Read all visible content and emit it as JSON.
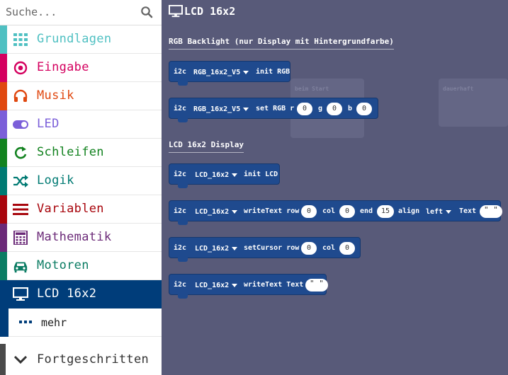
{
  "search": {
    "placeholder": "Suche..."
  },
  "categories": [
    {
      "label": "Grundlagen",
      "color": "#4fc0c2",
      "icon": "grid-icon"
    },
    {
      "label": "Eingabe",
      "color": "#d4005f",
      "icon": "target-icon"
    },
    {
      "label": "Musik",
      "color": "#e04810",
      "icon": "headphones-icon"
    },
    {
      "label": "LED",
      "color": "#7b5fd9",
      "icon": "toggle-icon"
    },
    {
      "label": "Schleifen",
      "color": "#12821f",
      "icon": "loop-icon"
    },
    {
      "label": "Logik",
      "color": "#007a73",
      "icon": "shuffle-icon"
    },
    {
      "label": "Variablen",
      "color": "#a8060d",
      "icon": "lines-icon"
    },
    {
      "label": "Mathematik",
      "color": "#6b2a78",
      "icon": "calculator-icon"
    },
    {
      "label": "Motoren",
      "color": "#0b7c63",
      "icon": "car-icon"
    },
    {
      "label": "LCD 16x2",
      "color": "#003d7a",
      "icon": "monitor-icon"
    }
  ],
  "more": {
    "label": "mehr",
    "icon": "ellipsis-icon"
  },
  "advanced": {
    "label": "Fortgeschritten",
    "icon": "chevron-down-icon"
  },
  "flyout": {
    "title": "LCD 16x2",
    "section1": "RGB Backlight (nur Display mit Hintergrundfarbe)",
    "section2": "LCD 16x2 Display",
    "ghost1": "beim Start",
    "ghost2": "dauerhaft"
  },
  "blocks": {
    "b1": {
      "prefix": "i2c",
      "dd": "RGB_16x2_V5",
      "text": "init RGB"
    },
    "b2": {
      "prefix": "i2c",
      "dd": "RGB_16x2_V5",
      "text": "set RGB r",
      "r": "0",
      "g_label": "g",
      "g": "0",
      "b_label": "b",
      "b": "0"
    },
    "b3": {
      "prefix": "i2c",
      "dd": "LCD_16x2",
      "text": "init LCD"
    },
    "b4": {
      "prefix": "i2c",
      "dd": "LCD_16x2",
      "text": "writeText row",
      "row": "0",
      "col_label": "col",
      "col": "0",
      "end_label": "end",
      "end": "15",
      "align_label": "align",
      "align": "left",
      "text_label": "Text",
      "text_val": "\" \""
    },
    "b5": {
      "prefix": "i2c",
      "dd": "LCD_16x2",
      "text": "setCursor row",
      "row": "0",
      "col_label": "col",
      "col": "0"
    },
    "b6": {
      "prefix": "i2c",
      "dd": "LCD_16x2",
      "text": "writeText Text",
      "text_val": "\" \""
    }
  }
}
